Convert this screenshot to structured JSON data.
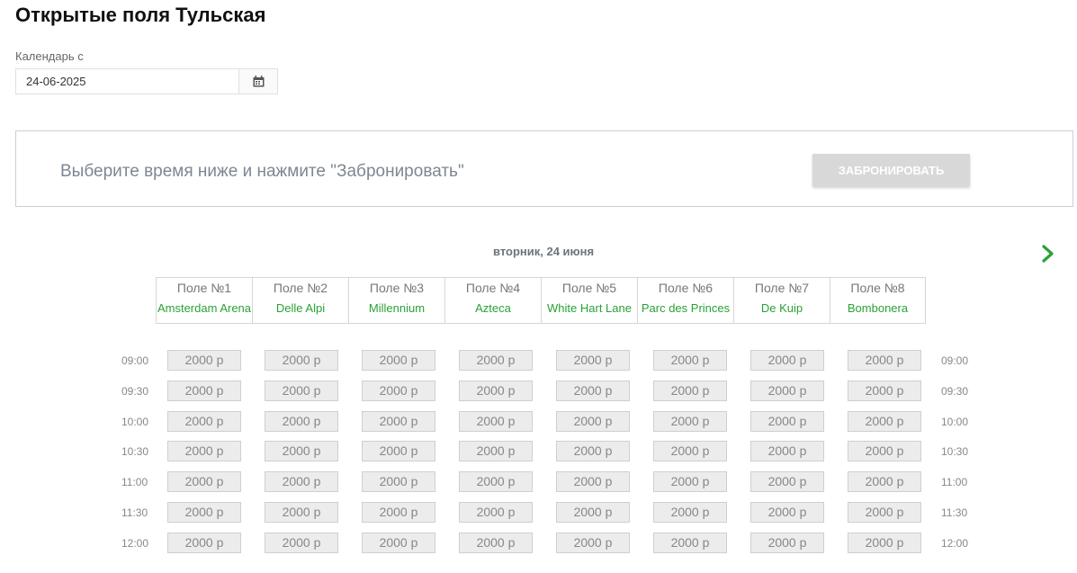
{
  "page": {
    "title": "Открытые поля Тульская"
  },
  "calendar": {
    "label": "Календарь с",
    "value": "24-06-2025",
    "icon": "calendar-icon"
  },
  "booking": {
    "hint": "Выберите время ниже и нажмите \"Забронировать\"",
    "button_label": "ЗАБРОНИРОВАТЬ"
  },
  "schedule": {
    "day_header": "вторник, 24 июня",
    "next_icon": "chevron-right-icon",
    "accent_color": "#2aa137",
    "fields": [
      {
        "number": "Поле №1",
        "name": "Amsterdam Arena"
      },
      {
        "number": "Поле №2",
        "name": "Delle Alpi"
      },
      {
        "number": "Поле №3",
        "name": "Millennium"
      },
      {
        "number": "Поле №4",
        "name": "Azteca"
      },
      {
        "number": "Поле №5",
        "name": "White Hart Lane"
      },
      {
        "number": "Поле №6",
        "name": "Parc des Princes"
      },
      {
        "number": "Поле №7",
        "name": "De Kuip"
      },
      {
        "number": "Поле №8",
        "name": "Bombonera"
      }
    ],
    "times": [
      "09:00",
      "09:30",
      "10:00",
      "10:30",
      "11:00",
      "11:30",
      "12:00"
    ],
    "slot_price": "2000 р"
  }
}
